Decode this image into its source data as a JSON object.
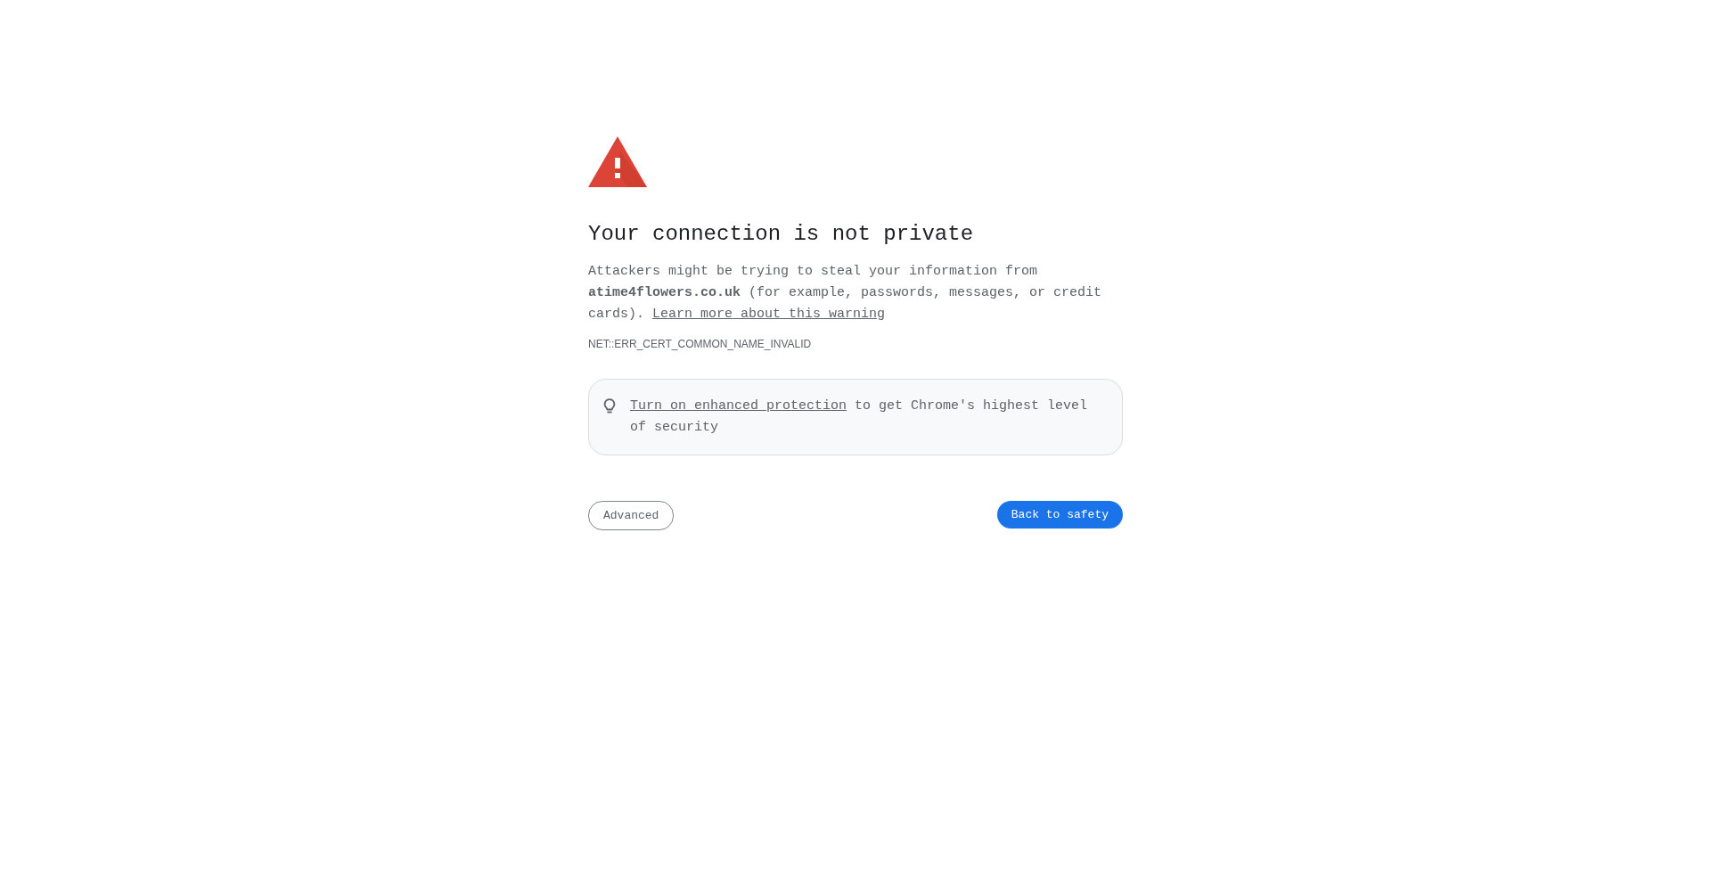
{
  "heading": "Your connection is not private",
  "description": {
    "text": "Attackers might be trying to steal your information from **atime4flowers.co.uk** (for example, passwords, messages, or credit cards).",
    "link": "Learn more about this warning"
  },
  "error_code": "NET::ERR_CERT_COMMON_NAME_INVALID",
  "protection_card": {
    "link": "Turn on enhanced protection",
    "text": "to get Chrome's highest level of security"
  },
  "buttons": [
    {
      "label": "Advanced",
      "kind": "secondary"
    },
    {
      "label": "Back to safety",
      "kind": "primary"
    }
  ]
}
